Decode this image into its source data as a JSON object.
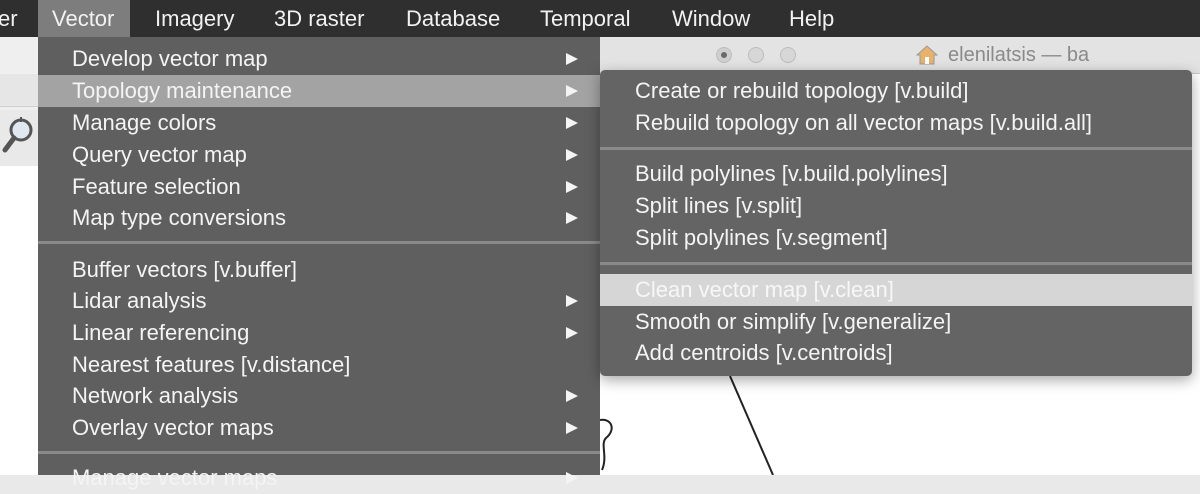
{
  "menubar": {
    "items": [
      "er",
      "Vector",
      "Imagery",
      "3D raster",
      "Database",
      "Temporal",
      "Window",
      "Help"
    ],
    "active": "Vector"
  },
  "window": {
    "title": "elenilatsis — ba",
    "icon": "home-icon"
  },
  "vector_menu": {
    "items": [
      {
        "label": "Develop vector map",
        "submenu": true
      },
      {
        "label": "Topology maintenance",
        "submenu": true,
        "highlighted": true
      },
      {
        "label": "Manage colors",
        "submenu": true
      },
      {
        "label": "Query vector map",
        "submenu": true
      },
      {
        "label": "Feature selection",
        "submenu": true
      },
      {
        "label": "Map type conversions",
        "submenu": true
      },
      {
        "label": "Buffer vectors   [v.buffer]",
        "submenu": false
      },
      {
        "label": "Lidar analysis",
        "submenu": true
      },
      {
        "label": "Linear referencing",
        "submenu": true
      },
      {
        "label": "Nearest features   [v.distance]",
        "submenu": false
      },
      {
        "label": "Network analysis",
        "submenu": true
      },
      {
        "label": "Overlay vector maps",
        "submenu": true
      },
      {
        "label": "Manage vector maps",
        "submenu": true
      }
    ]
  },
  "topology_menu": {
    "items": [
      {
        "label": "Create or rebuild topology   [v.build]"
      },
      {
        "label": "Rebuild topology on all vector maps   [v.build.all]"
      },
      {
        "label": "Build polylines   [v.build.polylines]"
      },
      {
        "label": "Split lines   [v.split]"
      },
      {
        "label": "Split polylines   [v.segment]"
      },
      {
        "label": "Clean vector map   [v.clean]",
        "selected": true
      },
      {
        "label": "Smooth or simplify   [v.generalize]"
      },
      {
        "label": "Add centroids   [v.centroids]"
      }
    ]
  },
  "colors": {
    "menubar": "#2f2f2f",
    "menu_bg": "#626262",
    "highlight": "#a3a3a3",
    "selected": "#d6d6d6"
  }
}
